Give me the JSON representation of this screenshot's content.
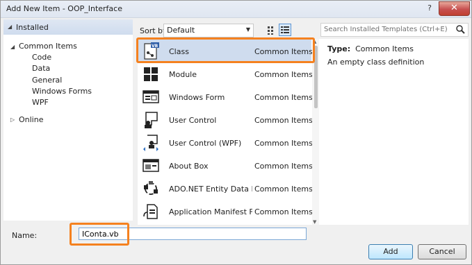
{
  "window": {
    "title": "Add New Item - OOP_Interface",
    "help_label": "?",
    "close_label": "✕"
  },
  "tree": {
    "installed": "Installed",
    "common_items": "Common Items",
    "children": [
      "Code",
      "Data",
      "General",
      "Windows Forms",
      "WPF"
    ],
    "online": "Online"
  },
  "sortbar": {
    "label": "Sort by:",
    "selected": "Default"
  },
  "templates": [
    {
      "name": "Class",
      "category": "Common Items",
      "icon": "vb-class-icon"
    },
    {
      "name": "Module",
      "category": "Common Items",
      "icon": "module-icon"
    },
    {
      "name": "Windows Form",
      "category": "Common Items",
      "icon": "windows-form-icon"
    },
    {
      "name": "User Control",
      "category": "Common Items",
      "icon": "user-control-icon"
    },
    {
      "name": "User Control (WPF)",
      "category": "Common Items",
      "icon": "wpf-user-control-icon"
    },
    {
      "name": "About Box",
      "category": "Common Items",
      "icon": "about-box-icon"
    },
    {
      "name": "ADO.NET Entity Data Mo...",
      "category": "Common Items",
      "icon": "entity-data-model-icon"
    },
    {
      "name": "Application Manifest File",
      "category": "Common Items",
      "icon": "manifest-file-icon"
    }
  ],
  "search": {
    "placeholder": "Search Installed Templates (Ctrl+E)"
  },
  "info": {
    "type_label": "Type:",
    "type_value": "Common Items",
    "description": "An empty class definition"
  },
  "name_field": {
    "label": "Name:",
    "value": "IConta.vb"
  },
  "buttons": {
    "add": "Add",
    "cancel": "Cancel"
  },
  "colors": {
    "highlight": "#f5811f",
    "selection": "#cfdcee"
  }
}
